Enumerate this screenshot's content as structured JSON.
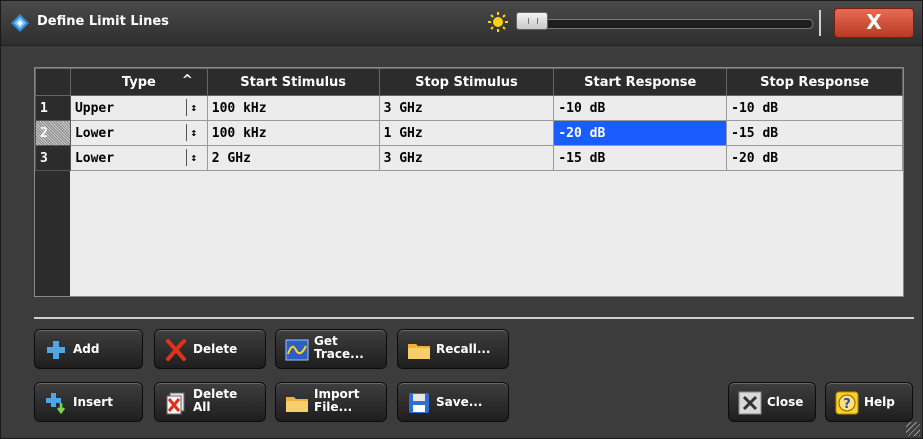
{
  "window": {
    "title": "Define Limit Lines",
    "close_glyph": "X"
  },
  "table": {
    "headers": [
      "Type",
      "Start Stimulus",
      "Stop Stimulus",
      "Start Response",
      "Stop Response"
    ],
    "sort_indicator": "^",
    "rows": [
      {
        "num": "1",
        "type": "Upper",
        "start_stimulus": "100 kHz",
        "stop_stimulus": "3 GHz",
        "start_response": "-10 dB",
        "stop_response": "-10 dB"
      },
      {
        "num": "2",
        "type": "Lower",
        "start_stimulus": "100 kHz",
        "stop_stimulus": "1 GHz",
        "start_response": "-20 dB",
        "stop_response": "-15 dB"
      },
      {
        "num": "3",
        "type": "Lower",
        "start_stimulus": "2 GHz",
        "stop_stimulus": "3 GHz",
        "start_response": "-15 dB",
        "stop_response": "-20 dB"
      }
    ],
    "spin_glyph": "↕"
  },
  "buttons": {
    "add": "Add",
    "delete": "Delete",
    "get_trace": [
      "Get",
      "Trace..."
    ],
    "recall": "Recall...",
    "insert": "Insert",
    "delete_all": [
      "Delete",
      "All"
    ],
    "import_file": [
      "Import",
      "File..."
    ],
    "save": "Save...",
    "close": "Close",
    "help": "Help"
  },
  "colors": {
    "selection": "#1a5dff",
    "close_red": "#c8442a"
  }
}
